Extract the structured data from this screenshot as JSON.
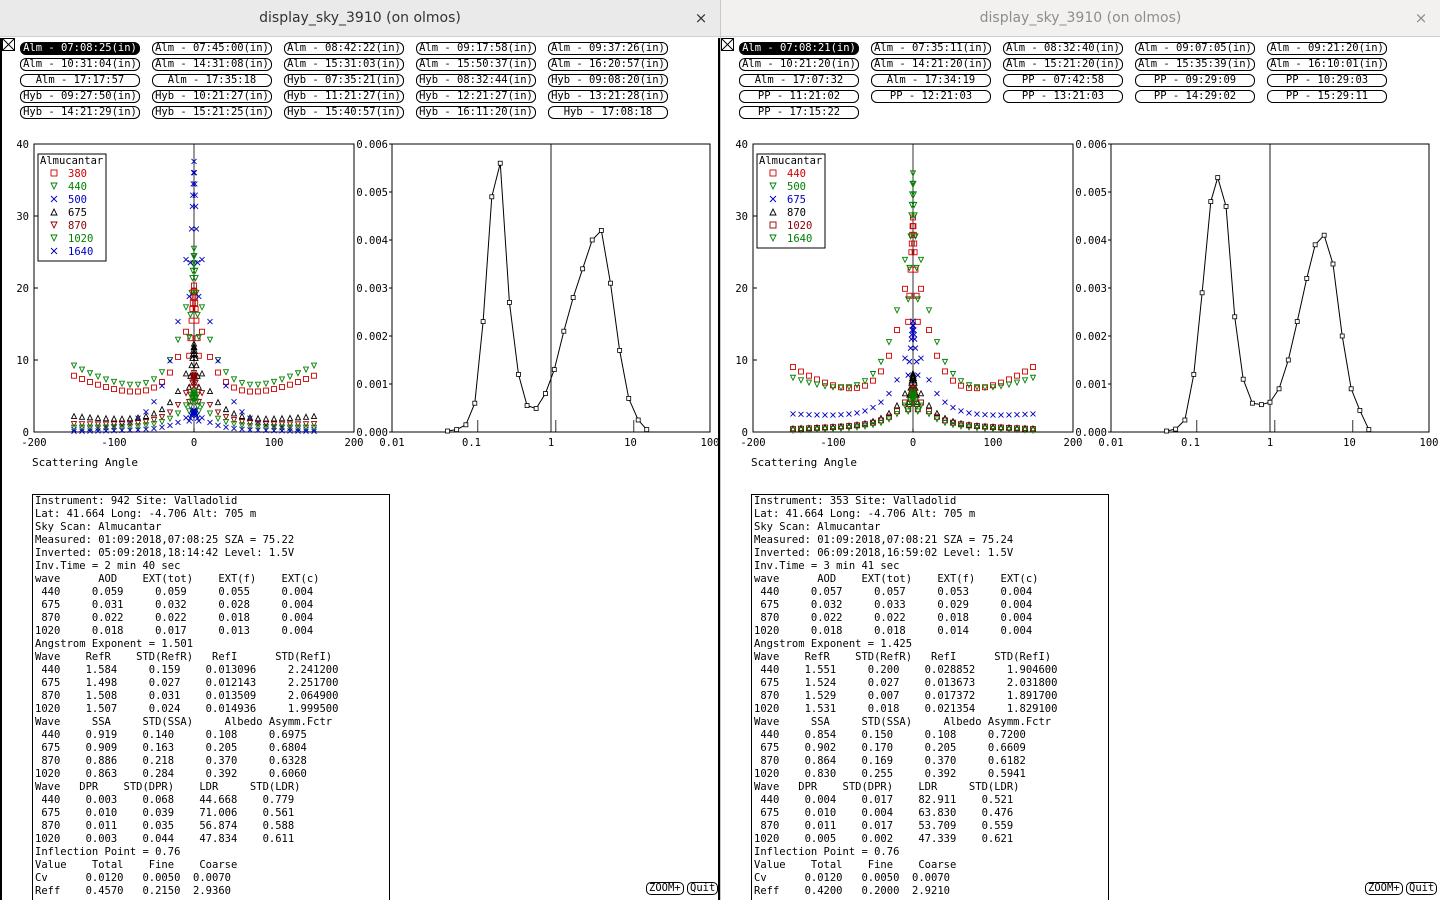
{
  "windows": [
    {
      "title": "display_sky_3910 (on olmos)",
      "close_label": "×",
      "scans": [
        [
          "Alm - 07:08:25(in)",
          "Alm - 07:45:00(in)",
          "Alm - 08:42:22(in)",
          "Alm - 09:17:58(in)",
          "Alm - 09:37:26(in)"
        ],
        [
          "Alm - 10:31:04(in)",
          "Alm - 14:31:08(in)",
          "Alm - 15:31:03(in)",
          "Alm - 15:50:37(in)",
          "Alm - 16:20:57(in)"
        ],
        [
          "Alm - 17:17:57",
          "Alm - 17:35:18",
          "Hyb - 07:35:21(in)",
          "Hyb - 08:32:44(in)",
          "Hyb - 09:08:20(in)"
        ],
        [
          "Hyb - 09:27:50(in)",
          "Hyb - 10:21:27(in)",
          "Hyb - 11:21:27(in)",
          "Hyb - 12:21:27(in)",
          "Hyb - 13:21:28(in)"
        ],
        [
          "Hyb - 14:21:29(in)",
          "Hyb - 15:21:25(in)",
          "Hyb - 15:40:57(in)",
          "Hyb - 16:11:20(in)",
          "Hyb - 17:08:18"
        ]
      ],
      "selected_scan": "Alm - 07:08:25(in)",
      "legend_title": "Almucantar",
      "legend": [
        {
          "label": "380",
          "color": "#d00000",
          "marker": "square"
        },
        {
          "label": "440",
          "color": "#008000",
          "marker": "tri-down"
        },
        {
          "label": "500",
          "color": "#0000c0",
          "marker": "x"
        },
        {
          "label": "675",
          "color": "#000000",
          "marker": "tri-up"
        },
        {
          "label": "870",
          "color": "#8b0000",
          "marker": "tri-down"
        },
        {
          "label": "1020",
          "color": "#008000",
          "marker": "tri-down"
        },
        {
          "label": "1640",
          "color": "#0000c0",
          "marker": "x"
        }
      ],
      "scatter_xlabel": "Scattering Angle",
      "info_lines": [
        "Instrument: 942 Site: Valladolid",
        "Lat: 41.664 Long: -4.706 Alt: 705 m",
        "Sky Scan: Almucantar",
        "Measured: 01:09:2018,07:08:25 SZA = 75.22",
        "Inverted: 05:09:2018,18:14:42 Level: 1.5V",
        "Inv.Time = 2 min 40 sec",
        "wave      AOD    EXT(tot)    EXT(f)    EXT(c)",
        " 440     0.059     0.059     0.055     0.004",
        " 675     0.031     0.032     0.028     0.004",
        " 870     0.022     0.022     0.018     0.004",
        "1020     0.018     0.017     0.013     0.004",
        "Angstrom Exponent = 1.501",
        "Wave    RefR    STD(RefR)   RefI      STD(RefI)",
        " 440    1.584     0.159    0.013096     2.241200",
        " 675    1.498     0.027    0.012143     2.251700",
        " 870    1.508     0.031    0.013509     2.064900",
        "1020    1.507     0.024    0.014936     1.999500",
        "Wave     SSA     STD(SSA)     Albedo Asymm.Fctr",
        " 440    0.919    0.140     0.108     0.6975",
        " 675    0.909    0.163     0.205     0.6804",
        " 870    0.886    0.218     0.370     0.6328",
        "1020    0.863    0.284     0.392     0.6060",
        "Wave   DPR    STD(DPR)    LDR     STD(LDR)",
        " 440    0.003    0.068    44.668    0.779",
        " 675    0.010    0.039    71.006    0.561",
        " 870    0.011    0.035    56.874    0.588",
        "1020    0.003    0.044    47.834    0.611",
        "Inflection Point = 0.76",
        "Value    Total    Fine    Coarse",
        "Cv      0.0120   0.0050  0.0070",
        "Reff    0.4570   0.2150  2.9360"
      ],
      "psd_y_ticks": [
        "0.006",
        "0.005",
        "0.004",
        "0.003",
        "0.002",
        "0.001",
        "0.000"
      ],
      "psd": [
        [
          0.05,
          2e-05
        ],
        [
          0.065,
          5e-05
        ],
        [
          0.085,
          0.00015
        ],
        [
          0.11,
          0.0006
        ],
        [
          0.14,
          0.0023
        ],
        [
          0.18,
          0.0049
        ],
        [
          0.23,
          0.0056
        ],
        [
          0.3,
          0.0027
        ],
        [
          0.39,
          0.0012
        ],
        [
          0.5,
          0.00055
        ],
        [
          0.65,
          0.00049
        ],
        [
          0.85,
          0.0008
        ],
        [
          1.1,
          0.0013
        ],
        [
          1.45,
          0.0021
        ],
        [
          1.9,
          0.0028
        ],
        [
          2.5,
          0.0034
        ],
        [
          3.3,
          0.004
        ],
        [
          4.3,
          0.0042
        ],
        [
          5.6,
          0.0031
        ],
        [
          7.3,
          0.0017
        ],
        [
          9.5,
          0.0007
        ],
        [
          12.5,
          0.00025
        ],
        [
          16,
          5e-05
        ]
      ],
      "zoom_label": "ZOOM+",
      "quit_label": "Quit"
    },
    {
      "title": "display_sky_3910 (on olmos)",
      "close_label": "×",
      "scans": [
        [
          "Alm - 07:08:21(in)",
          "Alm - 07:35:11(in)",
          "Alm - 08:32:40(in)",
          "Alm - 09:07:05(in)",
          "Alm - 09:21:20(in)"
        ],
        [
          "Alm - 10:21:20(in)",
          "Alm - 14:21:20(in)",
          "Alm - 15:21:20(in)",
          "Alm - 15:35:39(in)",
          "Alm - 16:10:01(in)"
        ],
        [
          "Alm - 17:07:32",
          "Alm - 17:34:19",
          "PP - 07:42:58",
          "PP - 09:29:09",
          "PP - 10:29:03"
        ],
        [
          "PP - 11:21:02",
          "PP - 12:21:03",
          "PP - 13:21:03",
          "PP - 14:29:02",
          "PP - 15:29:11"
        ],
        [
          "PP - 17:15:22"
        ]
      ],
      "selected_scan": "Alm - 07:08:21(in)",
      "legend_title": "Almucantar",
      "legend": [
        {
          "label": "440",
          "color": "#d00000",
          "marker": "square"
        },
        {
          "label": "500",
          "color": "#008000",
          "marker": "tri-down"
        },
        {
          "label": "675",
          "color": "#0000c0",
          "marker": "x"
        },
        {
          "label": "870",
          "color": "#000000",
          "marker": "tri-up"
        },
        {
          "label": "1020",
          "color": "#8b0000",
          "marker": "square"
        },
        {
          "label": "1640",
          "color": "#008000",
          "marker": "tri-down"
        }
      ],
      "scatter_xlabel": "Scattering Angle",
      "info_lines": [
        "Instrument: 353 Site: Valladolid",
        "Lat: 41.664 Long: -4.706 Alt: 705 m",
        "Sky Scan: Almucantar",
        "Measured: 01:09:2018,07:08:21 SZA = 75.24",
        "Inverted: 06:09:2018,16:59:02 Level: 1.5V",
        "Inv.Time = 3 min 41 sec",
        "wave      AOD    EXT(tot)    EXT(f)    EXT(c)",
        " 440     0.057     0.057     0.053     0.004",
        " 675     0.032     0.033     0.029     0.004",
        " 870     0.022     0.022     0.018     0.004",
        "1020     0.018     0.018     0.014     0.004",
        "Angstrom Exponent = 1.425",
        "Wave    RefR    STD(RefR)   RefI      STD(RefI)",
        " 440    1.551     0.200    0.028852     1.904600",
        " 675    1.524     0.027    0.013673     2.031800",
        " 870    1.529     0.007    0.017372     1.891700",
        "1020    1.531     0.018    0.021354     1.829100",
        "Wave     SSA     STD(SSA)     Albedo Asymm.Fctr",
        " 440    0.854    0.150     0.108     0.7200",
        " 675    0.902    0.170     0.205     0.6609",
        " 870    0.864    0.169     0.370     0.6182",
        "1020    0.830    0.255     0.392     0.5941",
        "Wave   DPR    STD(DPR)    LDR     STD(LDR)",
        " 440    0.004    0.017    82.911    0.521",
        " 675    0.010    0.004    63.830    0.476",
        " 870    0.011    0.017    53.709    0.559",
        "1020    0.005    0.002    47.339    0.621",
        "Inflection Point = 0.76",
        "Value    Total    Fine    Coarse",
        "Cv      0.0120   0.0050  0.0070",
        "Reff    0.4200   0.2000  2.9210"
      ],
      "psd_y_ticks": [
        "0.006",
        "0.005",
        "0.004",
        "0.003",
        "0.002",
        "0.001",
        "0.000"
      ],
      "psd": [
        [
          0.05,
          2e-05
        ],
        [
          0.065,
          6e-05
        ],
        [
          0.085,
          0.00025
        ],
        [
          0.11,
          0.0012
        ],
        [
          0.14,
          0.0029
        ],
        [
          0.18,
          0.0048
        ],
        [
          0.22,
          0.0053
        ],
        [
          0.28,
          0.0047
        ],
        [
          0.36,
          0.0024
        ],
        [
          0.46,
          0.0011
        ],
        [
          0.6,
          0.0006
        ],
        [
          0.78,
          0.00057
        ],
        [
          1.0,
          0.00062
        ],
        [
          1.3,
          0.0009
        ],
        [
          1.7,
          0.0015
        ],
        [
          2.2,
          0.0023
        ],
        [
          2.9,
          0.0032
        ],
        [
          3.7,
          0.0039
        ],
        [
          4.8,
          0.0041
        ],
        [
          6.2,
          0.0035
        ],
        [
          8.1,
          0.002
        ],
        [
          10.5,
          0.0009
        ],
        [
          13.5,
          0.00045
        ],
        [
          17.5,
          5e-05
        ]
      ],
      "zoom_label": "ZOOM+",
      "quit_label": "Quit"
    }
  ],
  "chart_data": [
    {
      "type": "scatter",
      "title": "",
      "xlabel": "Scattering Angle",
      "ylabel": "",
      "xlim": [
        -200,
        200
      ],
      "ylim": [
        0,
        40
      ],
      "x_ticks": [
        "-200",
        "-100",
        "0",
        "100",
        "200"
      ],
      "y_ticks": [
        "40",
        "30",
        "20",
        "10",
        "0"
      ],
      "legend_title": "Almucantar",
      "series_peaks": [
        {
          "name": "380",
          "center": 4.2,
          "peak": 19.5,
          "edge": 7.8
        },
        {
          "name": "440",
          "center": 4.8,
          "peak": 24.5,
          "edge": 9.2
        },
        {
          "name": "500",
          "center": 0.4,
          "peak": 37.5,
          "edge": 0.3
        },
        {
          "name": "675",
          "center": 1.4,
          "peak": 12,
          "edge": 2.2
        },
        {
          "name": "870",
          "center": 0.9,
          "peak": 8,
          "edge": 1.1
        },
        {
          "name": "1020",
          "center": 0.6,
          "peak": 5.5,
          "edge": 0.6
        },
        {
          "name": "1640",
          "center": 0.2,
          "peak": 3,
          "edge": 0.1
        }
      ]
    },
    {
      "type": "line",
      "title": "",
      "xlabel": "",
      "ylabel": "",
      "x_scale": "log",
      "xlim": [
        0.01,
        100
      ],
      "ylim": [
        0,
        0.006
      ],
      "x_ticks": [
        "0.01",
        "0.1",
        "1",
        "10",
        "100"
      ],
      "y_ticks": [
        "0.006",
        "0.005",
        "0.004",
        "0.003",
        "0.002",
        "0.001",
        "0.000"
      ]
    },
    {
      "type": "scatter",
      "title": "",
      "xlabel": "Scattering Angle",
      "ylabel": "",
      "xlim": [
        -200,
        200
      ],
      "ylim": [
        0,
        40
      ],
      "x_ticks": [
        "-200",
        "-100",
        "0",
        "100",
        "200"
      ],
      "y_ticks": [
        "40",
        "30",
        "20",
        "10",
        "0"
      ],
      "legend_title": "Almucantar",
      "series_peaks": [
        {
          "name": "440",
          "center": 4.0,
          "peak": 29,
          "edge": 9
        },
        {
          "name": "500",
          "center": 4.6,
          "peak": 35,
          "edge": 7.5
        },
        {
          "name": "675",
          "center": 2.0,
          "peak": 15,
          "edge": 2.5
        },
        {
          "name": "870",
          "center": 0.8,
          "peak": 8,
          "edge": 0.5
        },
        {
          "name": "1020",
          "center": 0.8,
          "peak": 6,
          "edge": 0.4
        },
        {
          "name": "1640",
          "center": 0.5,
          "peak": 5.5,
          "edge": 0.2
        }
      ]
    },
    {
      "type": "line",
      "title": "",
      "xlabel": "",
      "ylabel": "",
      "x_scale": "log",
      "xlim": [
        0.01,
        100
      ],
      "ylim": [
        0,
        0.006
      ],
      "x_ticks": [
        "0.01",
        "0.1",
        "1",
        "10",
        "100"
      ],
      "y_ticks": [
        "0.006",
        "0.005",
        "0.004",
        "0.003",
        "0.002",
        "0.001",
        "0.000"
      ]
    }
  ]
}
